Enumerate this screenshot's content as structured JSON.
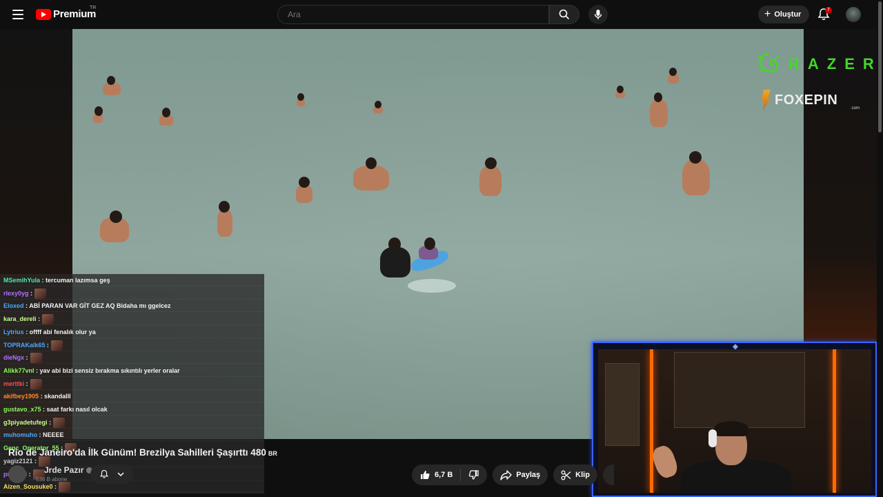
{
  "header": {
    "logo_text": "Premium",
    "country_code": "TR",
    "search_placeholder": "Ara",
    "create_label": "Oluştur",
    "notification_count": "7"
  },
  "overlay": {
    "razer_text": "RAZER",
    "foxepin_text": "FOXEPIN",
    "foxepin_domain": ".com"
  },
  "chat": {
    "messages": [
      {
        "user": "MSemihYula",
        "color": "#54e6a8",
        "text": ": tercuman lazımsa geş",
        "emote": false
      },
      {
        "user": "rlexy0yg",
        "color": "#b070ff",
        "text": ":",
        "emote": true
      },
      {
        "user": "Eloxed",
        "color": "#4aa8ff",
        "text": ": ABİ PARAN VAR GİT GEZ AQ Bidaha mı ggelcez",
        "emote": false
      },
      {
        "user": "kara_dereli",
        "color": "#c8ff8a",
        "text": ":",
        "emote": true
      },
      {
        "user": "Lytrius",
        "color": "#4aa8ff",
        "text": ": offff abi fenalık olur ya",
        "emote": false
      },
      {
        "user": "TOPRAKalk65",
        "color": "#4aa8ff",
        "text": ":",
        "emote": true
      },
      {
        "user": "dieNgx",
        "color": "#b070ff",
        "text": ":",
        "emote": true
      },
      {
        "user": "Alikk77vnl",
        "color": "#8aff5a",
        "text": ": yav abi bizi sensiz bırakma sıkıntılı yerler oralar",
        "emote": false
      },
      {
        "user": "merttki",
        "color": "#ff4a4a",
        "text": ":",
        "emote": true
      },
      {
        "user": "akifbey1905",
        "color": "#ff8a2a",
        "text": ": skandalll",
        "emote": false
      },
      {
        "user": "gustavo_x75",
        "color": "#8aff5a",
        "text": ": saat farkı nasıl olcak",
        "emote": false
      },
      {
        "user": "g3piyadetufegi",
        "color": "#c8ff8a",
        "text": ":",
        "emote": true
      },
      {
        "user": "muhomuho",
        "color": "#4aa8ff",
        "text": ": NEEEE",
        "emote": false
      },
      {
        "user": "Genc_Operator_55",
        "color": "#8aff5a",
        "text": ":",
        "emote": true
      },
      {
        "user": "yagiz2121",
        "color": "#c8c8c8",
        "text": ":",
        "emote": true
      },
      {
        "user": "puyamii",
        "color": "#b070ff",
        "text": ":",
        "emote": true
      },
      {
        "user": "Aizen_Sousuke0",
        "color": "#ffdd66",
        "text": ":",
        "emote": true
      }
    ]
  },
  "video": {
    "title": "Rio de Janeiro'da İlk Günüm! Brezilya Sahilleri Şaşırttı 480",
    "title_suffix": "BR",
    "channel_name": "Jrde Pazır",
    "subscribers": "536 B abone",
    "likes": "6,7 B",
    "share_label": "Paylaş",
    "clip_label": "Klip"
  },
  "icons": {
    "menu": "menu-icon",
    "search": "search-icon",
    "mic": "mic-icon",
    "bell": "bell-icon",
    "like": "thumbs-up-icon",
    "dislike": "thumbs-down-icon",
    "share": "share-icon",
    "clip": "scissors-icon"
  },
  "colors": {
    "razer_green": "#44d62c",
    "webcam_border": "#3a66ff",
    "neon": "#ff6a00"
  }
}
